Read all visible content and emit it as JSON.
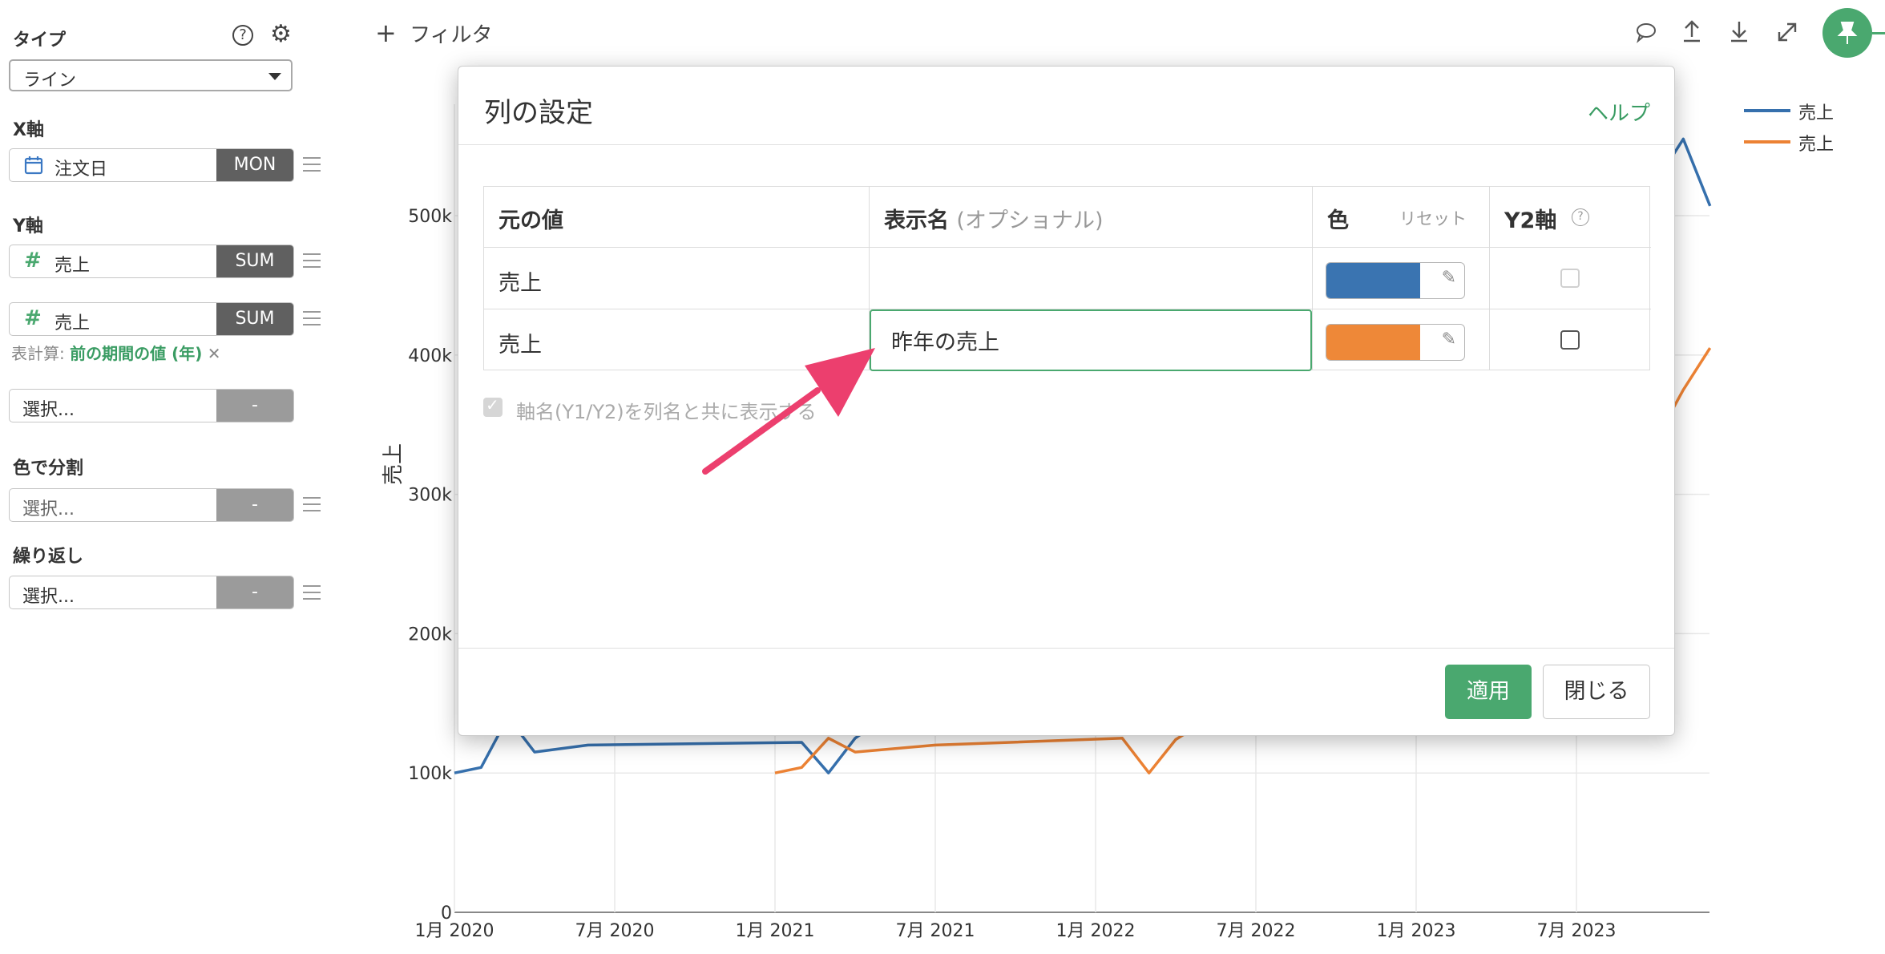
{
  "sidebar": {
    "type_label": "タイプ",
    "type_value": "ライン",
    "x_axis_label": "X軸",
    "x_field": {
      "name": "注文日",
      "agg": "MON"
    },
    "y_axis_label": "Y軸",
    "y_fields": [
      {
        "name": "売上",
        "agg": "SUM"
      },
      {
        "name": "売上",
        "agg": "SUM"
      }
    ],
    "table_calc_label": "表計算:",
    "table_calc_value": "前の期間の値 (年)",
    "table_calc_remove": "✕",
    "extra_select": {
      "placeholder": "選択...",
      "agg": "-"
    },
    "color_split_label": "色で分割",
    "color_split_select": {
      "placeholder": "選択...",
      "agg": "-"
    },
    "repeat_label": "繰り返し",
    "repeat_select": {
      "placeholder": "選択...",
      "agg": "-"
    }
  },
  "toolbar": {
    "filter_plus": "+",
    "filter_label": "フィルタ"
  },
  "chart_data": {
    "type": "line",
    "ylabel": "売上",
    "y_ticks": [
      "0",
      "100k",
      "200k",
      "300k",
      "400k",
      "500k"
    ],
    "ylim": [
      0,
      580000
    ],
    "x_ticks": [
      "1月 2020",
      "7月 2020",
      "1月 2021",
      "7月 2021",
      "1月 2022",
      "7月 2022",
      "1月 2023",
      "7月 2023"
    ],
    "legend": [
      "売上",
      "売上"
    ],
    "colors": [
      "#3670ad",
      "#ec8234"
    ],
    "series": [
      {
        "name": "売上",
        "values": [
          [
            0,
            100000
          ],
          [
            1,
            104000
          ],
          [
            2,
            140000
          ],
          [
            3,
            115000
          ],
          [
            5,
            120000
          ],
          [
            13,
            122000
          ],
          [
            14,
            100000
          ],
          [
            15,
            125000
          ],
          [
            45,
            525000
          ],
          [
            46,
            555000
          ],
          [
            47,
            507000
          ]
        ]
      },
      {
        "name": "売上",
        "values": [
          [
            12,
            100000
          ],
          [
            13,
            104000
          ],
          [
            14,
            125000
          ],
          [
            15,
            115000
          ],
          [
            18,
            120000
          ],
          [
            25,
            125000
          ],
          [
            26,
            100000
          ],
          [
            27,
            124000
          ],
          [
            45,
            340000
          ],
          [
            46,
            375000
          ],
          [
            47,
            405000
          ]
        ]
      }
    ]
  },
  "modal": {
    "title": "列の設定",
    "help": "ヘルプ",
    "headers": {
      "source": "元の値",
      "display": "表示名",
      "display_hint": "(オプショナル)",
      "color": "色",
      "color_reset": "リセット",
      "y2": "Y2軸",
      "y2_help": "?"
    },
    "rows": [
      {
        "source": "売上",
        "display": "",
        "color": "#3a74b1",
        "y2": false
      },
      {
        "source": "売上",
        "display": "昨年の売上",
        "color": "#ee8838",
        "y2": false
      }
    ],
    "show_axis_name": "軸名(Y1/Y2)を列名と共に表示する",
    "apply": "適用",
    "close": "閉じる"
  }
}
